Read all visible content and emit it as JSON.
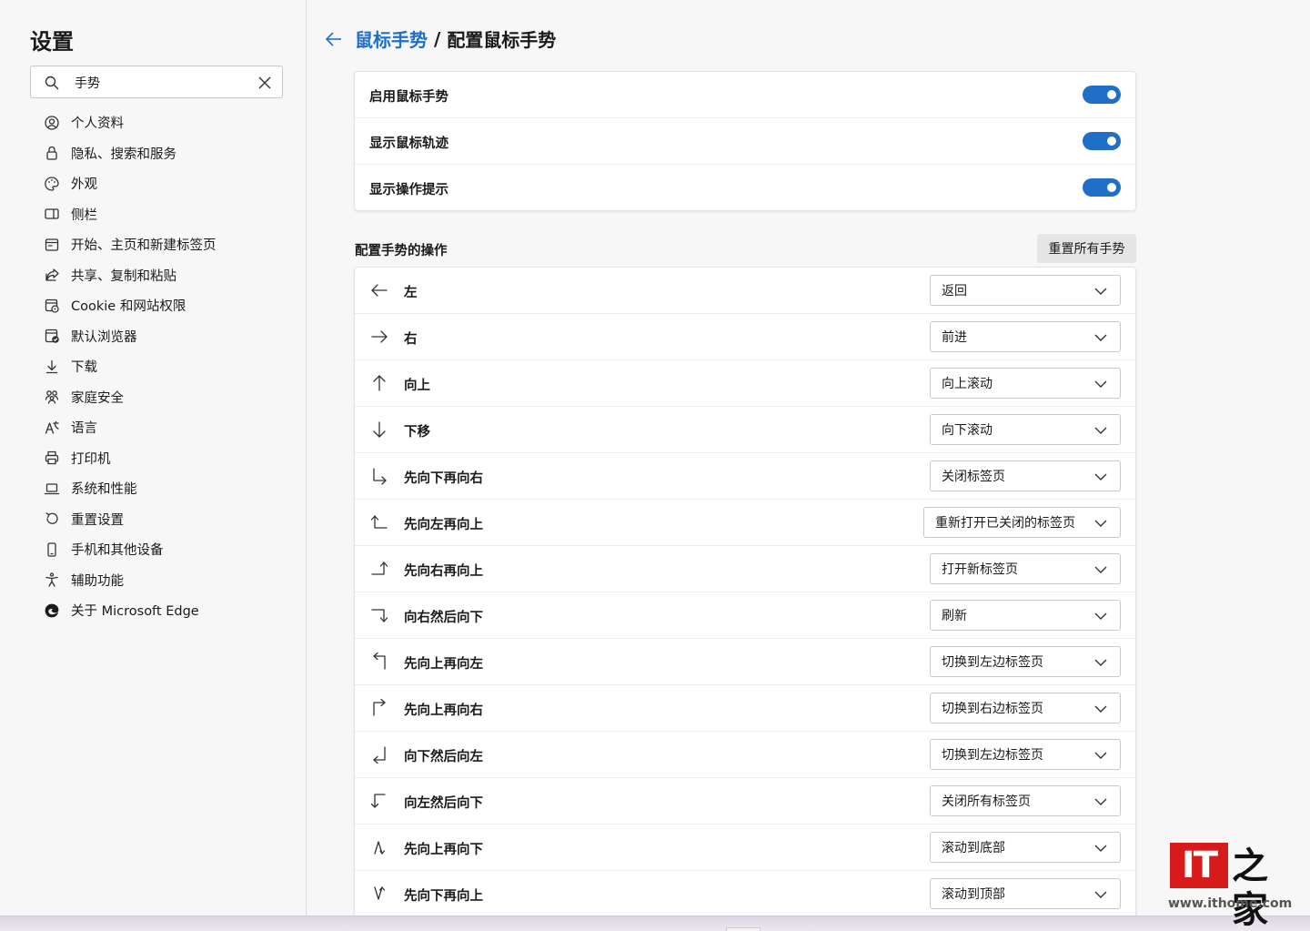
{
  "sidebar": {
    "title": "设置",
    "search": {
      "value": "手势"
    },
    "items": [
      {
        "label": "个人资料",
        "icon": "profile-icon"
      },
      {
        "label": "隐私、搜索和服务",
        "icon": "lock-icon"
      },
      {
        "label": "外观",
        "icon": "palette-icon"
      },
      {
        "label": "侧栏",
        "icon": "sidebar-icon"
      },
      {
        "label": "开始、主页和新建标签页",
        "icon": "home-tab-icon"
      },
      {
        "label": "共享、复制和粘贴",
        "icon": "share-icon"
      },
      {
        "label": "Cookie 和网站权限",
        "icon": "cookie-icon"
      },
      {
        "label": "默认浏览器",
        "icon": "default-browser-icon"
      },
      {
        "label": "下载",
        "icon": "download-icon"
      },
      {
        "label": "家庭安全",
        "icon": "family-icon"
      },
      {
        "label": "语言",
        "icon": "language-icon"
      },
      {
        "label": "打印机",
        "icon": "printer-icon"
      },
      {
        "label": "系统和性能",
        "icon": "laptop-icon"
      },
      {
        "label": "重置设置",
        "icon": "reset-icon"
      },
      {
        "label": "手机和其他设备",
        "icon": "phone-icon"
      },
      {
        "label": "辅助功能",
        "icon": "accessibility-icon"
      },
      {
        "label": "关于 Microsoft Edge",
        "icon": "edge-icon"
      }
    ]
  },
  "header": {
    "parent": "鼠标手势",
    "separator": "/",
    "current": "配置鼠标手势"
  },
  "toggles": [
    {
      "label": "启用鼠标手势",
      "on": true
    },
    {
      "label": "显示鼠标轨迹",
      "on": true
    },
    {
      "label": "显示操作提示",
      "on": true
    }
  ],
  "gestures_section": {
    "title": "配置手势的操作",
    "reset_label": "重置所有手势",
    "rows": [
      {
        "label": "左",
        "icon": "arrow-left-icon",
        "action": "返回"
      },
      {
        "label": "右",
        "icon": "arrow-right-icon",
        "action": "前进"
      },
      {
        "label": "向上",
        "icon": "arrow-up-icon",
        "action": "向上滚动"
      },
      {
        "label": "下移",
        "icon": "arrow-down-icon",
        "action": "向下滚动"
      },
      {
        "label": "先向下再向右",
        "icon": "down-right-icon",
        "action": "关闭标签页"
      },
      {
        "label": "先向左再向上",
        "icon": "left-up-icon",
        "action": "重新打开已关闭的标签页"
      },
      {
        "label": "先向右再向上",
        "icon": "right-up-icon",
        "action": "打开新标签页"
      },
      {
        "label": "向右然后向下",
        "icon": "right-down-icon",
        "action": "刷新"
      },
      {
        "label": "先向上再向左",
        "icon": "up-left-icon",
        "action": "切换到左边标签页"
      },
      {
        "label": "先向上再向右",
        "icon": "up-right-icon",
        "action": "切换到右边标签页"
      },
      {
        "label": "向下然后向左",
        "icon": "down-left-icon",
        "action": "切换到左边标签页"
      },
      {
        "label": "向左然后向下",
        "icon": "left-down-icon",
        "action": "关闭所有标签页"
      },
      {
        "label": "先向上再向下",
        "icon": "up-down-icon",
        "action": "滚动到底部"
      },
      {
        "label": "先向下再向上",
        "icon": "down-up-icon",
        "action": "滚动到顶部"
      }
    ]
  },
  "watermark": {
    "logo": "IT",
    "name": "之家",
    "url": "www.ithome.com"
  },
  "colors": {
    "accent": "#1f6fc9",
    "toggle_on": "#1f6fc9",
    "brand_red": "#d71a1a"
  }
}
